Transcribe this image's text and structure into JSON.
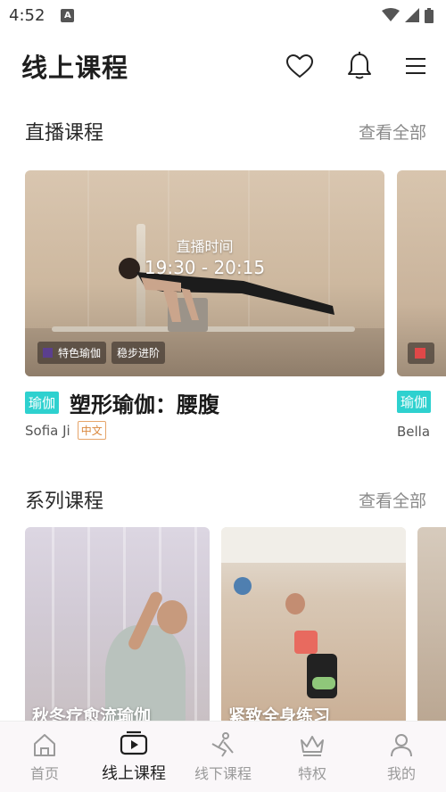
{
  "status_bar": {
    "time": "4:52",
    "notification_badge": "A"
  },
  "header": {
    "title": "线上课程",
    "icons": [
      "heart-icon",
      "bell-icon",
      "menu-icon"
    ]
  },
  "live_section": {
    "title": "直播课程",
    "more": "查看全部",
    "card": {
      "overlay_label": "直播时间",
      "overlay_time": "19:30 - 20:15",
      "tags": [
        "特色瑜伽",
        "稳步进阶"
      ],
      "category": "瑜伽",
      "course_title": "塑形瑜伽：腰腹",
      "teacher": "Sofia Ji",
      "language": "中文"
    },
    "peek_card": {
      "category": "瑜伽",
      "teacher": "Bella"
    }
  },
  "series_section": {
    "title": "系列课程",
    "more": "查看全部",
    "cards": [
      {
        "label": "秋冬疗愈流瑜伽"
      },
      {
        "label": "紧致全身练习"
      }
    ]
  },
  "bottom_nav": {
    "items": [
      {
        "label": "首页",
        "icon": "home-icon",
        "active": false
      },
      {
        "label": "线上课程",
        "icon": "video-play-icon",
        "active": true
      },
      {
        "label": "线下课程",
        "icon": "yoga-pose-icon",
        "active": false
      },
      {
        "label": "特权",
        "icon": "crown-icon",
        "active": false
      },
      {
        "label": "我的",
        "icon": "user-icon",
        "active": false
      }
    ]
  },
  "colors": {
    "category_badge": "#2ed1cf",
    "language_badge": "#d9873c",
    "text_primary": "#1e1e1e",
    "text_secondary": "#8a8a8a"
  }
}
